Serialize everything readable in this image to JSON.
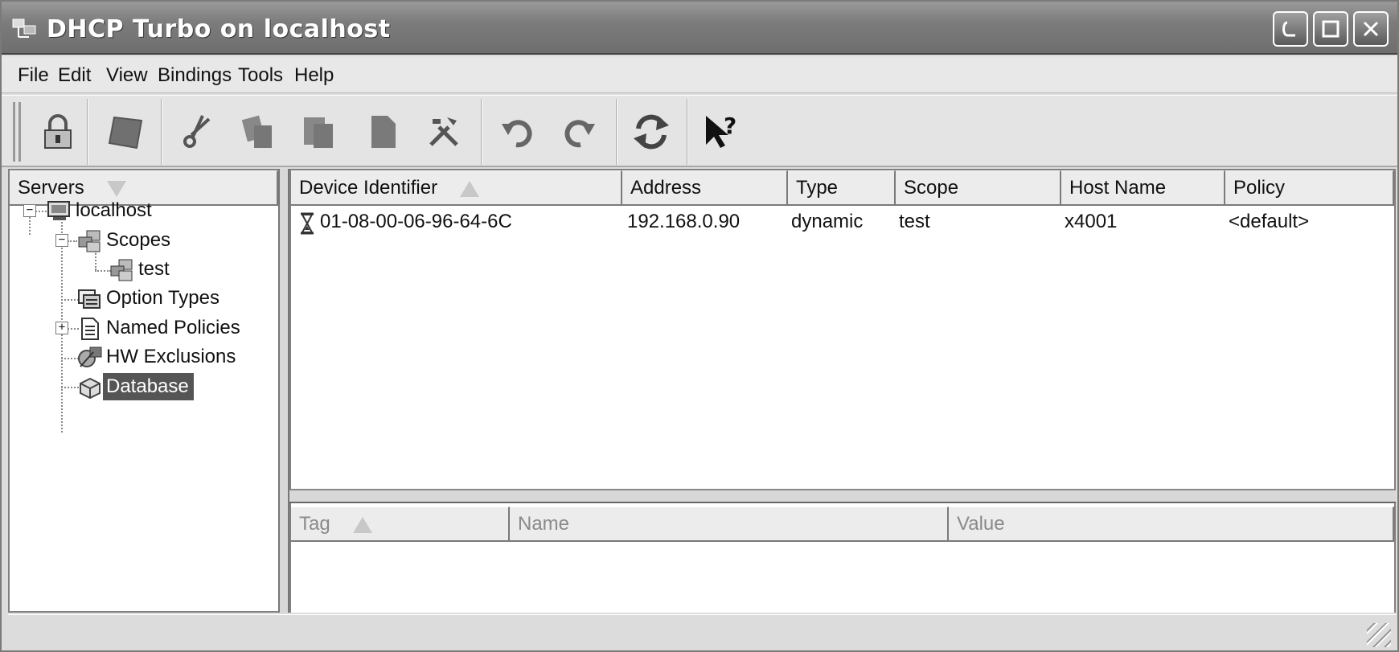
{
  "window": {
    "title": "DHCP Turbo on localhost"
  },
  "menu": [
    "File",
    "Edit",
    "View",
    "Bindings",
    "Tools",
    "Help"
  ],
  "toolbar": {
    "buttons": [
      {
        "name": "lock-icon"
      },
      {
        "name": "stop-icon"
      },
      {
        "name": "cut-icon"
      },
      {
        "name": "copy-icon"
      },
      {
        "name": "paste-icon"
      },
      {
        "name": "document-icon"
      },
      {
        "name": "tools-icon"
      },
      {
        "name": "undo-icon"
      },
      {
        "name": "redo-icon"
      },
      {
        "name": "refresh-icon"
      },
      {
        "name": "whats-this-help-icon"
      }
    ]
  },
  "left_pane": {
    "header": "Servers",
    "tree": {
      "root": "localhost",
      "scopes": "Scopes",
      "scope_child": "test",
      "option_types": "Option Types",
      "named_policies": "Named Policies",
      "hw_exclusions": "HW Exclusions",
      "database": "Database"
    }
  },
  "bindings_table": {
    "columns": [
      "Device Identifier",
      "Address",
      "Type",
      "Scope",
      "Host Name",
      "Policy"
    ],
    "rows": [
      {
        "device_identifier": "01-08-00-06-96-64-6C",
        "address": "192.168.0.90",
        "type": "dynamic",
        "scope": "test",
        "host_name": "x4001",
        "policy": "<default>"
      }
    ]
  },
  "options_table": {
    "columns": [
      "Tag",
      "Name",
      "Value"
    ]
  }
}
